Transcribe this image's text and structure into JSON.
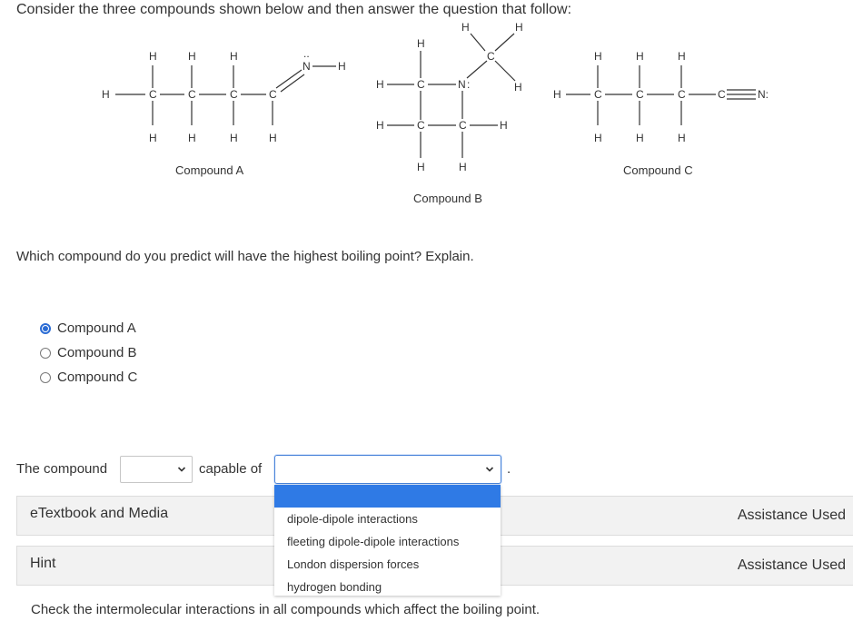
{
  "question": {
    "title": "Consider the three compounds shown below and then answer the question that follow:",
    "prompt": "Which compound do you predict will have the highest boiling point? Explain."
  },
  "structures": {
    "compound_a": {
      "label": "Compound A",
      "atoms": {
        "h": "H",
        "c": "C",
        "n": "N",
        "lone_pair": ".."
      }
    },
    "compound_b": {
      "label": "Compound B",
      "atoms": {
        "h": "H",
        "c": "C",
        "n": "N",
        "lone_pair": ":"
      }
    },
    "compound_c": {
      "label": "Compound C",
      "atoms": {
        "h": "H",
        "c": "C",
        "n": "N:"
      }
    }
  },
  "choices": [
    {
      "label": "Compound A",
      "selected": true
    },
    {
      "label": "Compound B",
      "selected": false
    },
    {
      "label": "Compound C",
      "selected": false
    }
  ],
  "explanation": {
    "lead_text": "The compound",
    "select1_value": "",
    "mid_text": "capable of",
    "select2_value": "",
    "end_text": "."
  },
  "dropdown": {
    "options": [
      "",
      "dipole-dipole interactions",
      "fleeting dipole-dipole interactions",
      "London dispersion forces",
      "hydrogen bonding"
    ],
    "highlighted_index": 0
  },
  "panels": {
    "etextbook": {
      "title": "eTextbook and Media",
      "status": "Assistance Used"
    },
    "hint": {
      "title": "Hint",
      "status": "Assistance Used",
      "text": "Check the intermolecular interactions in all compounds which affect the boiling point."
    }
  },
  "colors": {
    "accent": "#2f7ae5",
    "radio": "#2b6cd4",
    "panel_bg": "#f2f2f2"
  }
}
